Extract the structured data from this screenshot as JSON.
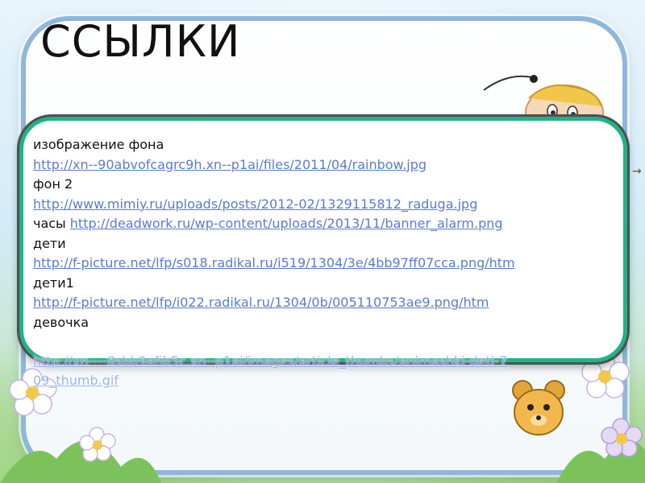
{
  "slide": {
    "title": "ССЫЛКИ",
    "edge_text": "→"
  },
  "links": [
    {
      "label": "изображение фона",
      "url": "http://xn--90abvofcagrc9h.xn--p1ai/files/2011/04/rainbow.jpg"
    },
    {
      "label": "фон 2",
      "url": "http://www.mimiy.ru/uploads/posts/2012-02/1329115812_raduga.jpg"
    },
    {
      "label": "часы",
      "url": "http://deadwork.ru/wp-content/uploads/2013/11/banner_alarm.png"
    },
    {
      "label": "дети",
      "url": "http://f-picture.net/lfp/s018.radikal.ru/i519/1304/3e/4bb97ff07cca.png/htm"
    },
    {
      "label": "дети1",
      "url": "http://f-picture.net/lfp/i022.radikal.ru/1304/0b/005110753ae9.png/htm"
    },
    {
      "label": "девочка",
      "url_line1": "http://xn----8sbb9afib5c.xn--p1ai/images/article_thumbs/animashki-deti-7",
      "url_line2": "09_thumb.gif"
    }
  ],
  "colors": {
    "frame_border": "#8fb6dc",
    "panel_border": "#1fb387",
    "link": "#5b7bd1"
  }
}
